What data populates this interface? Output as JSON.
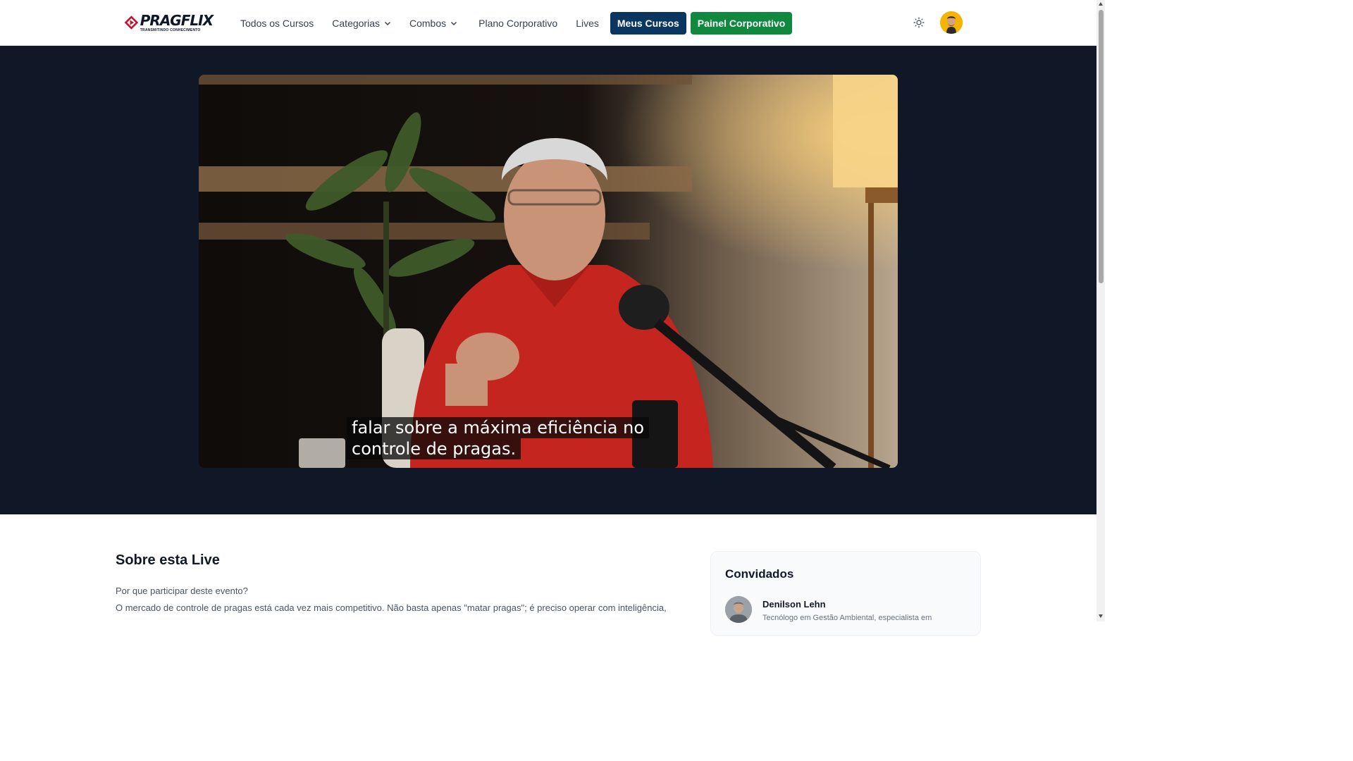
{
  "brand": {
    "name": "PRAGFLIX",
    "tagline": "TRANSMITINDO CONHECIMENTO"
  },
  "nav": {
    "todos_cursos": "Todos os Cursos",
    "categorias": "Categorias",
    "combos": "Combos",
    "plano_corporativo": "Plano Corporativo",
    "lives": "Lives",
    "meus_cursos": "Meus Cursos",
    "painel_corporativo": "Painel Corporativo"
  },
  "video": {
    "caption_line1": "falar sobre a máxima eficiência no",
    "caption_line2": "controle de pragas."
  },
  "about": {
    "title": "Sobre esta Live",
    "question": "Por que participar deste evento?",
    "paragraph": "O mercado de controle de pragas está cada vez mais competitivo. Não basta apenas \"matar pragas\"; é preciso operar com inteligência,"
  },
  "guests": {
    "title": "Convidados",
    "items": [
      {
        "name": "Denilson Lehn",
        "role": "Tecnólogo em Gestão Ambiental, especialista em"
      }
    ]
  },
  "colors": {
    "hero_bg": "#101828",
    "btn_meus_cursos": "#0b3660",
    "btn_painel": "#10893e",
    "brand_red": "#c8102e"
  }
}
